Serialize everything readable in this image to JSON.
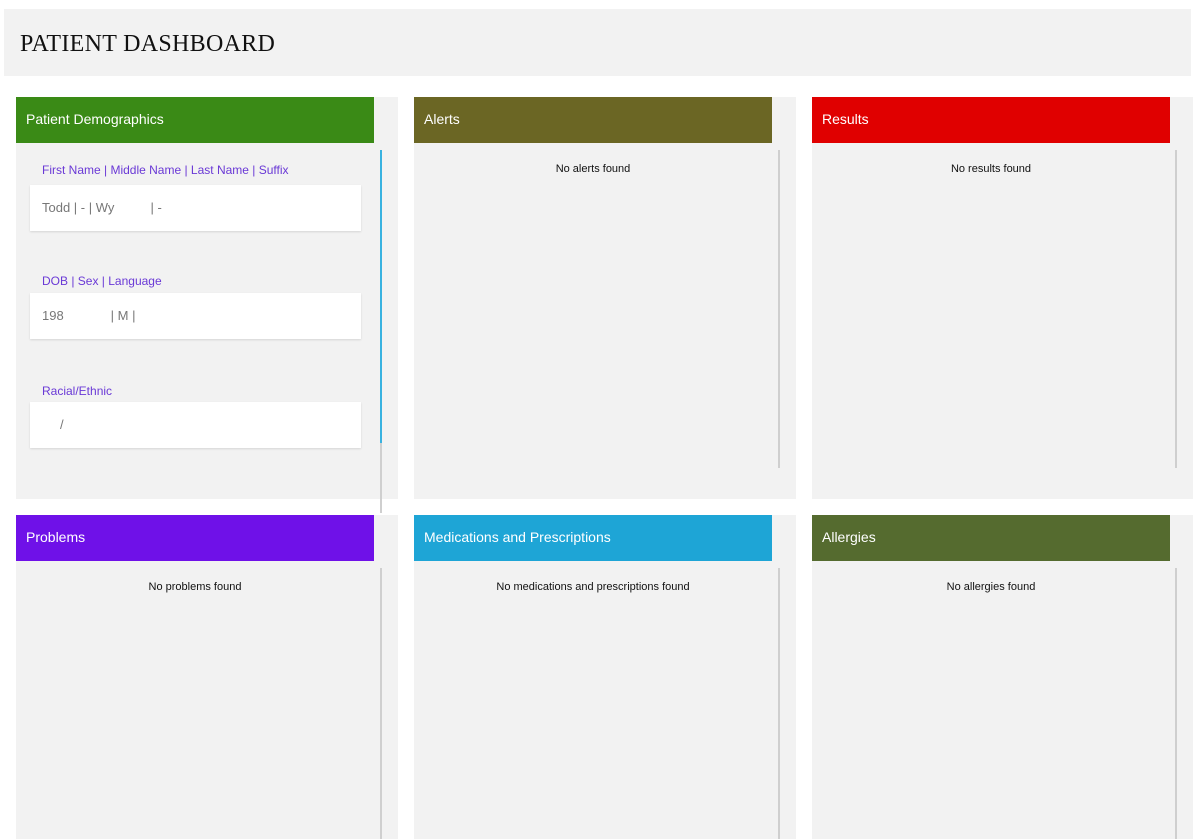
{
  "page": {
    "title": "PATIENT DASHBOARD"
  },
  "demographics": {
    "header": "Patient Demographics",
    "header_color": "#3a8a16",
    "name_label": "First Name | Middle Name | Last Name | Suffix",
    "name_value": "Todd | - | Wy          | -",
    "dob_label": "DOB | Sex | Language",
    "dob_value": "198             | M |",
    "race_label": "Racial/Ethnic",
    "race_value": "/"
  },
  "alerts": {
    "header": "Alerts",
    "header_color": "#6b6624",
    "empty": "No alerts found"
  },
  "results": {
    "header": "Results",
    "header_color": "#e00000",
    "empty": "No results found"
  },
  "problems": {
    "header": "Problems",
    "header_color": "#6f11e8",
    "empty": "No problems found"
  },
  "medications": {
    "header": "Medications and Prescriptions",
    "header_color": "#1ea5d6",
    "empty": "No medications and prescriptions found"
  },
  "allergies": {
    "header": "Allergies",
    "header_color": "#556b2f",
    "empty": "No allergies found"
  }
}
